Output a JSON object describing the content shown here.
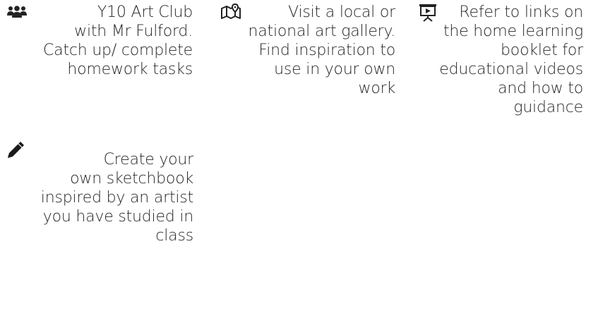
{
  "activities": [
    {
      "icon": "people-group-icon",
      "lines": [
        "Y10 Art Club",
        "with Mr Fulford.",
        "Catch up/ complete",
        "homework tasks"
      ]
    },
    {
      "icon": "map-marker-icon",
      "lines": [
        "Visit a local or",
        "national art gallery.",
        "Find inspiration to",
        "use in your own",
        "work"
      ]
    },
    {
      "icon": "video-presentation-icon",
      "lines": [
        "Refer to links on",
        "the home learning",
        "booklet for",
        "educational videos",
        "and how to",
        "guidance"
      ]
    },
    {
      "icon": "pencil-icon",
      "lines": [
        "Create your",
        "own sketchbook",
        "inspired by an artist",
        "you have studied in",
        "class"
      ]
    }
  ]
}
